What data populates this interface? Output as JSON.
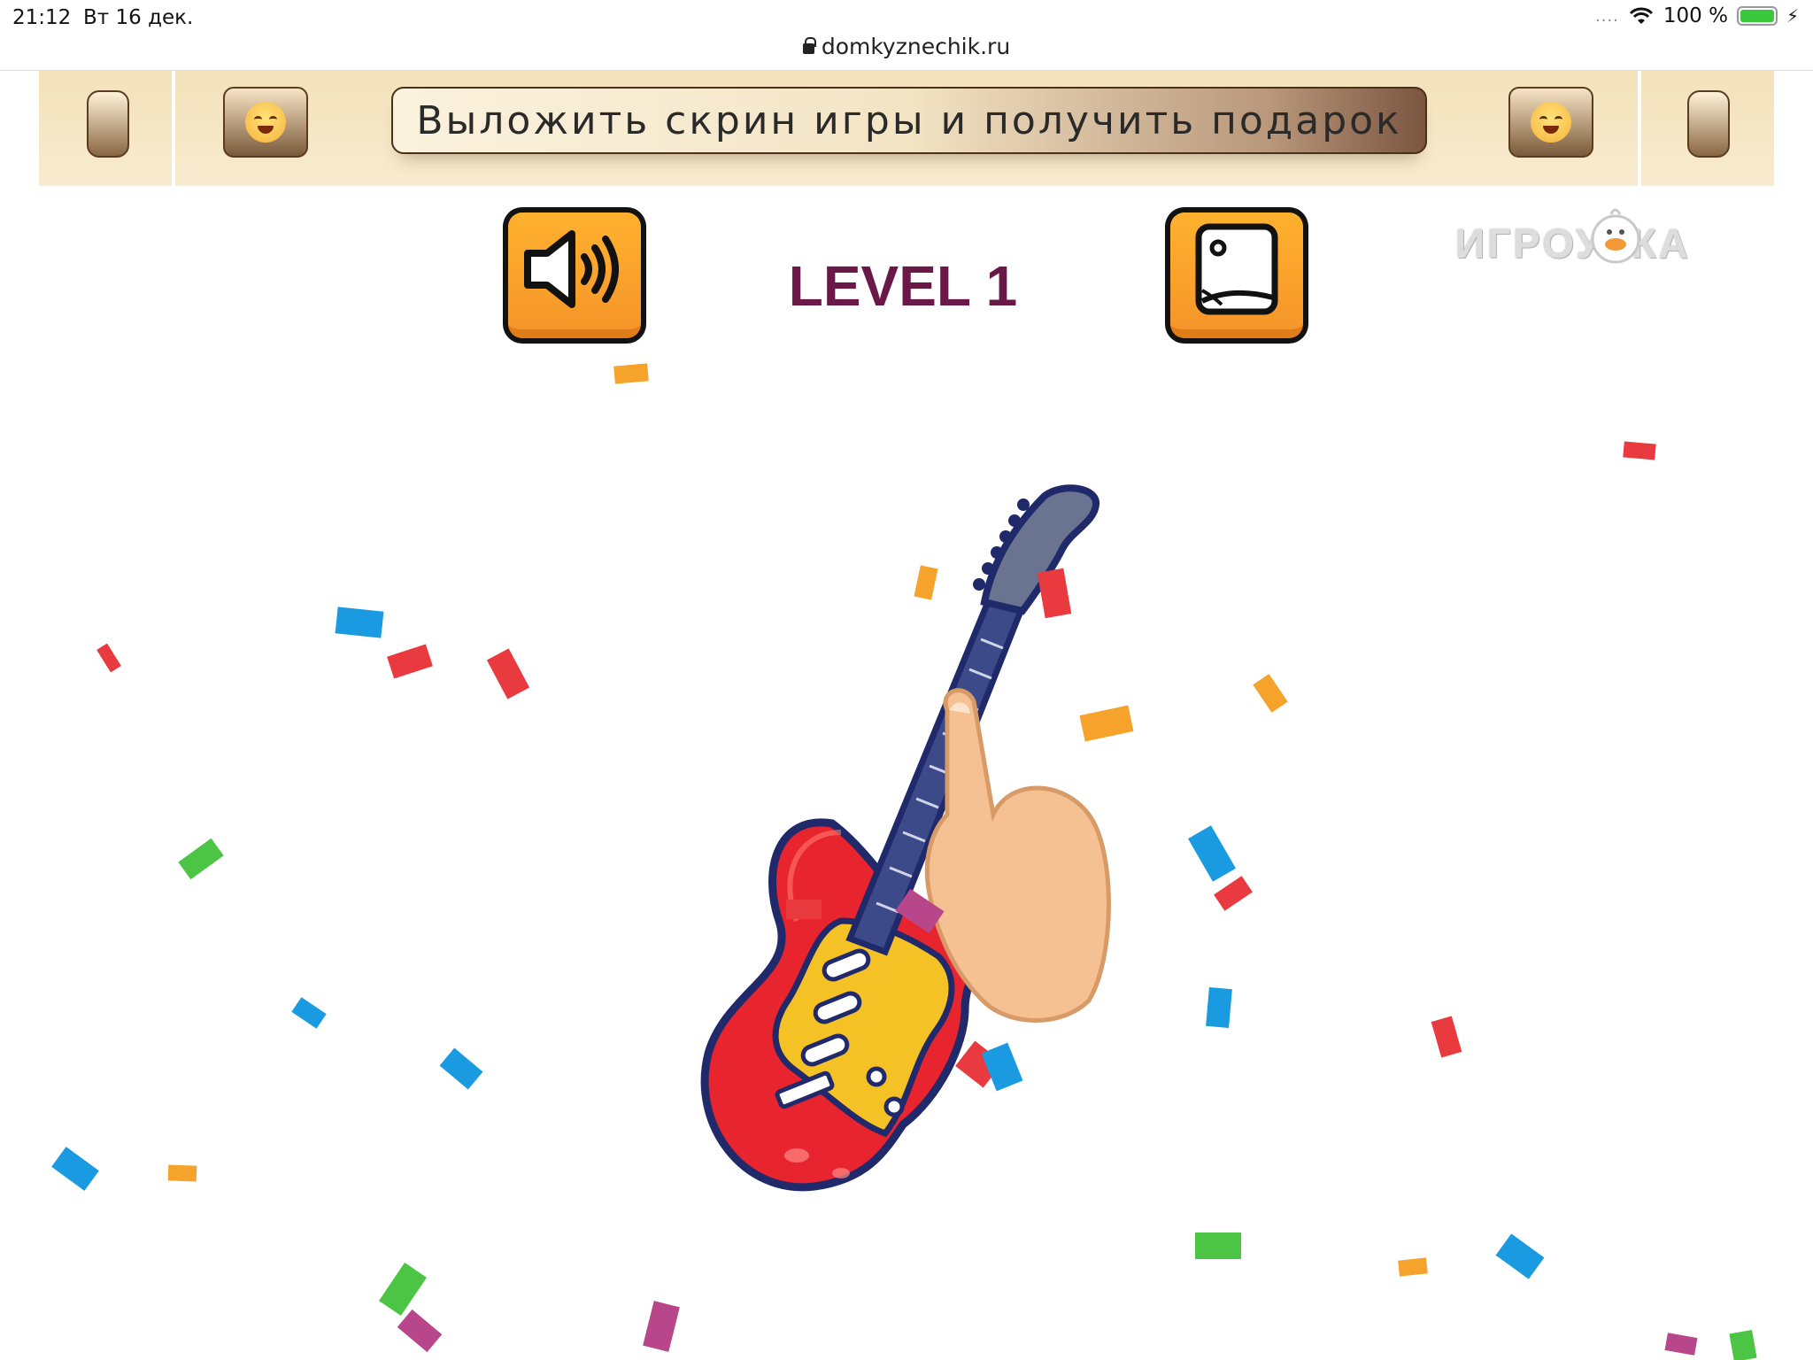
{
  "status_bar": {
    "time": "21:12",
    "date": "Вт 16 дек.",
    "battery": "100 %",
    "signal_dots": "....",
    "charging_icon": "bolt-icon"
  },
  "browser": {
    "url": "domkyznechik.ru",
    "lock_icon": "lock-icon"
  },
  "banner": {
    "cta_label": "Выложить скрин игры и получить подарок",
    "emoji": "hugging-face-emoji"
  },
  "game": {
    "level_label": "LEVEL 1",
    "logo_text": "ИГРОУТКА",
    "sound_icon": "speaker-icon",
    "fullscreen_icon": "fullscreen-icon",
    "hint_icon": "pointing-hand-icon",
    "artwork": "electric-guitar"
  },
  "colors": {
    "button_orange": "#f5a32a",
    "level_text": "#6a1848",
    "banner_bg": "#f3e2ba",
    "guitar_body": "#e8242f",
    "pickguard": "#f5c225",
    "outline": "#202a6b"
  }
}
